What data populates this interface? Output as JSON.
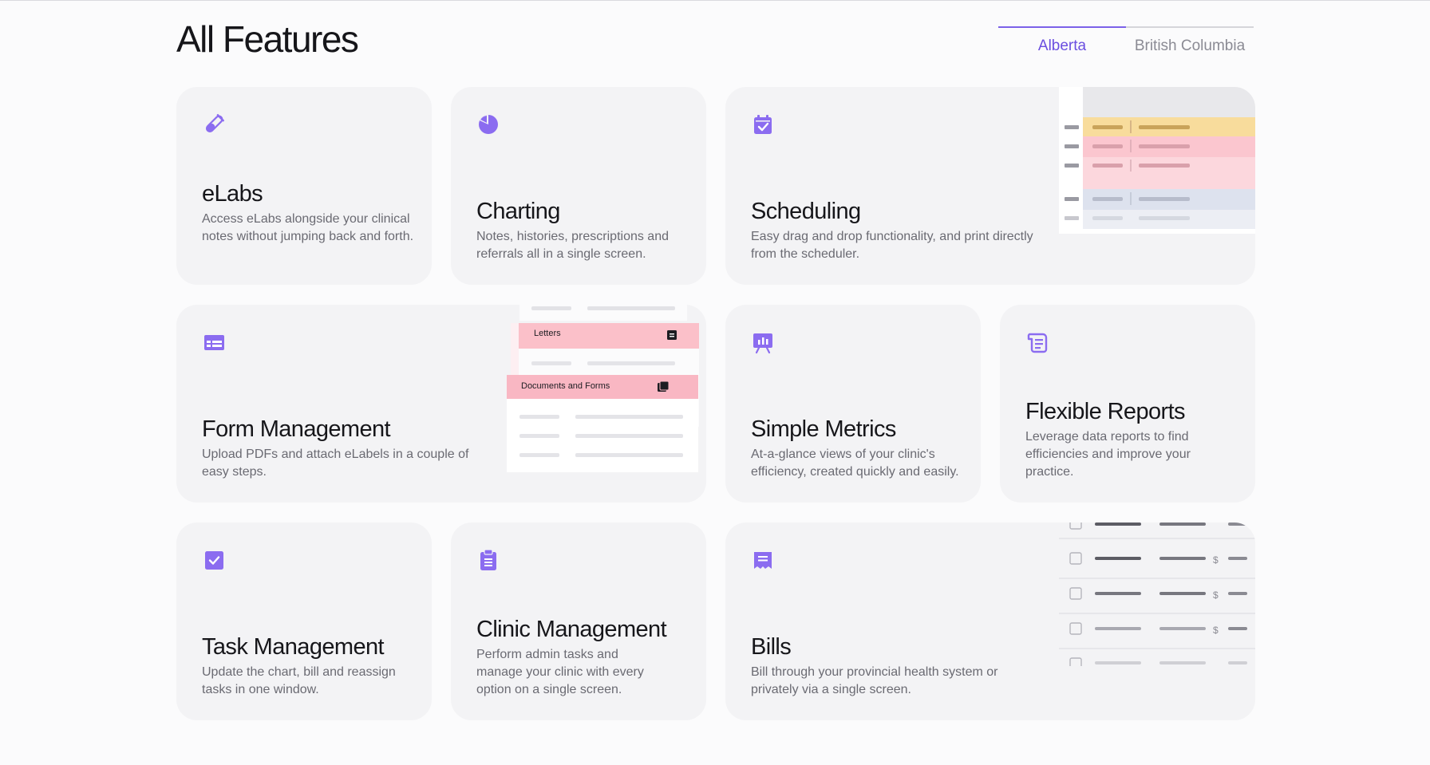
{
  "page": {
    "title": "All Features"
  },
  "tabs": [
    {
      "label": "Alberta",
      "active": true
    },
    {
      "label": "British Columbia",
      "active": false
    }
  ],
  "colors": {
    "accent": "#7b61e8",
    "card_bg": "#f3f3f5",
    "pink": "#fbc6cf",
    "yellow": "#f8dc9c",
    "blue": "#dde2ee"
  },
  "features": {
    "elabs": {
      "icon": "test-tube-icon",
      "title": "eLabs",
      "desc": "Access eLabs alongside your clinical notes without jumping back and forth."
    },
    "charting": {
      "icon": "pie-chart-icon",
      "title": "Charting",
      "desc": "Notes, histories, prescriptions and referrals all in a single screen."
    },
    "scheduling": {
      "icon": "calendar-check-icon",
      "title": "Scheduling",
      "desc": "Easy drag and drop functionality, and print directly from the scheduler."
    },
    "forms": {
      "icon": "table-icon",
      "title": "Form Management",
      "desc": "Upload PDFs and attach eLabels in a couple of easy steps.",
      "illus": {
        "letters": "Letters",
        "documents": "Documents and Forms"
      }
    },
    "metrics": {
      "icon": "presentation-chart-icon",
      "title": "Simple Metrics",
      "desc": "At-a-glance views of your clinic's efficiency, created quickly and easily."
    },
    "reports": {
      "icon": "scroll-icon",
      "title": "Flexible Reports",
      "desc": "Leverage data reports to find efficiencies and improve your practice."
    },
    "tasks": {
      "icon": "checkbox-icon",
      "title": "Task Management",
      "desc": "Update the chart, bill and reassign tasks in one window."
    },
    "clinic": {
      "icon": "clipboard-icon",
      "title": "Clinic Management",
      "desc": "Perform admin tasks and manage your clinic with every option on a single screen."
    },
    "bills": {
      "icon": "receipt-icon",
      "title": "Bills",
      "desc": "Bill through your provincial health system or privately via a single screen.",
      "currency": "$"
    }
  }
}
